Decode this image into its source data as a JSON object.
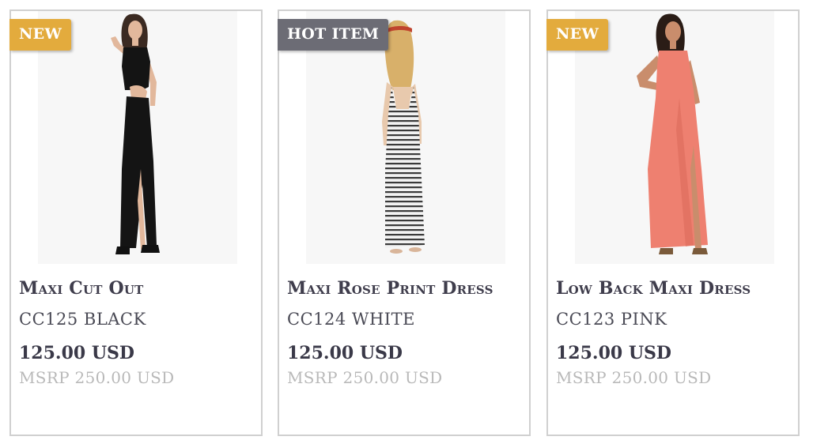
{
  "products": [
    {
      "badge": "NEW",
      "badge_color": "#e3ab3d",
      "name": "Maxi Cut Out",
      "sku": "CC125 BLACK",
      "price": "125.00 USD",
      "msrp": "MSRP 250.00 USD",
      "dress_color": "#151515"
    },
    {
      "badge": "HOT ITEM",
      "badge_color": "#6c6c75",
      "name": "Maxi Rose Print Dress",
      "sku": "CC124 WHITE",
      "price": "125.00 USD",
      "msrp": "MSRP 250.00 USD",
      "dress_color": "#e8e8e8"
    },
    {
      "badge": "NEW",
      "badge_color": "#e3ab3d",
      "name": "Low Back Maxi Dress",
      "sku": "CC123 PINK",
      "price": "125.00 USD",
      "msrp": "MSRP 250.00 USD",
      "dress_color": "#ee8070"
    }
  ]
}
